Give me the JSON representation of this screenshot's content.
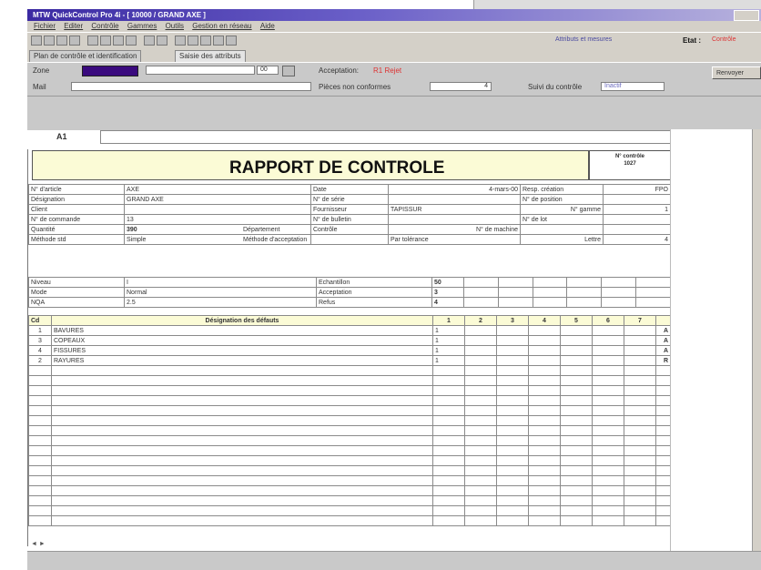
{
  "window": {
    "title": "MTW QuickControl Pro 4i - [ 10000 / GRAND AXE ]"
  },
  "menu": [
    "Fichier",
    "Editer",
    "Contrôle",
    "Gammes",
    "Outils",
    "Gestion en réseau",
    "Aide"
  ],
  "toolbar": {
    "attr_label": "Attributs et mesures",
    "etat_label": "Etat :",
    "etat_value": "Contrôle"
  },
  "tabs": [
    "Plan de contrôle et identification",
    "Saisie des attributs"
  ],
  "form": {
    "zone_label": "Zone",
    "zone_number": "00",
    "mail_label": "Mail",
    "acceptation_label": "Acceptation:",
    "acceptation_value": "R1 Rejet",
    "pieces_label": "Pièces non conformes",
    "pieces_value": "4",
    "suivi_label": "Suivi du contrôle",
    "suivi_value": "Inactif",
    "cell_ref": "A1",
    "renvoyer_label": "Renvoyer"
  },
  "report": {
    "title": "RAPPORT DE CONTROLE",
    "num_label": "N° contrôle",
    "num_value": "1027",
    "rows": [
      {
        "l1": "N° d'article",
        "v1": "AXE",
        "l2": "Date",
        "v2": "4-mars-00",
        "l3": "Resp. création",
        "v3": "FPO"
      },
      {
        "l1": "Désignation",
        "v1": "GRAND AXE",
        "l2": "N° de série",
        "v2": "",
        "l3": "N° de position",
        "v3": ""
      },
      {
        "l1": "Client",
        "v1": "",
        "l2": "Fournisseur",
        "v2": "TAPISSUR",
        "l3": "N° gamme",
        "v3": "1"
      },
      {
        "l1": "N° de commande",
        "v1": "13",
        "l2": "N° de bulletin",
        "v2": "",
        "l3": "N° de lot",
        "v3": ""
      },
      {
        "l1": "Quantité",
        "v1": "390",
        "l1b": "Département",
        "l2": "Contrôle",
        "v2": "",
        "l3": "N° de machine",
        "v3": ""
      }
    ],
    "method": {
      "l1": "Méthode std",
      "v1": "Simple",
      "l2": "Méthode d'acceptation",
      "v2": "Par tolérance",
      "l3": "Lettre",
      "v3": "4"
    },
    "params": [
      {
        "label": "Niveau",
        "value": "I",
        "label2": "Echantillon",
        "value2": "50"
      },
      {
        "label": "Mode",
        "value": "Normal",
        "label2": "Acceptation",
        "value2": "3"
      },
      {
        "label": "NQA",
        "value": "2.5",
        "label2": "Refus",
        "value2": "4"
      }
    ],
    "defects_header": {
      "col": "Cd",
      "title": "Désignation des défauts",
      "nums": [
        "1",
        "2",
        "3",
        "4",
        "5",
        "6",
        "7"
      ]
    },
    "defects": [
      {
        "code": "1",
        "name": "BAVURES",
        "v1": "1",
        "grade": "A"
      },
      {
        "code": "3",
        "name": "COPEAUX",
        "v1": "1",
        "grade": "A"
      },
      {
        "code": "4",
        "name": "FISSURES",
        "v1": "1",
        "grade": "A"
      },
      {
        "code": "2",
        "name": "RAYURES",
        "v1": "1",
        "grade": "R"
      }
    ]
  },
  "status": {
    "sheet_nav": "◄ ►"
  }
}
